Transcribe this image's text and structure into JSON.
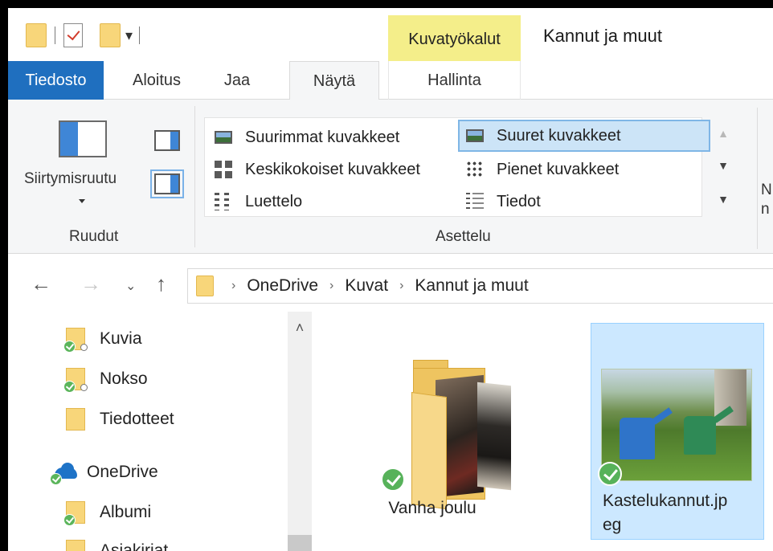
{
  "titlebar": {
    "contextual_tab": "Kuvatyökalut",
    "window_title": "Kannut ja muut"
  },
  "tabs": {
    "file": "Tiedosto",
    "home": "Aloitus",
    "share": "Jaa",
    "view": "Näytä",
    "manage": "Hallinta"
  },
  "ribbon": {
    "panes_button": "Siirtymisruutu",
    "panes_group": "Ruudut",
    "layout_group": "Asettelu",
    "layout_items": [
      "Suurimmat kuvakkeet",
      "Suuret kuvakkeet",
      "Keskikokoiset kuvakkeet",
      "Pienet kuvakkeet",
      "Luettelo",
      "Tiedot"
    ],
    "selected_layout": "Suuret kuvakkeet",
    "cut_off_line1": "N",
    "cut_off_line2": "n"
  },
  "address": {
    "crumbs": [
      "OneDrive",
      "Kuvat",
      "Kannut ja muut"
    ]
  },
  "navpane": {
    "items": [
      "Kuvia",
      "Nokso",
      "Tiedotteet",
      "OneDrive",
      "Albumi",
      "Asiakirjat"
    ]
  },
  "files": [
    {
      "name": "Vanha joulu",
      "type": "folder",
      "selected": false
    },
    {
      "name_line1": "Kastelukannut.jp",
      "name_line2": "eg",
      "type": "image",
      "selected": true
    }
  ],
  "colors": {
    "file_tab": "#1f6fbf",
    "contextual_tab": "#f4ee8a",
    "selection": "#cce8ff",
    "sync_ok": "#57b25a"
  }
}
